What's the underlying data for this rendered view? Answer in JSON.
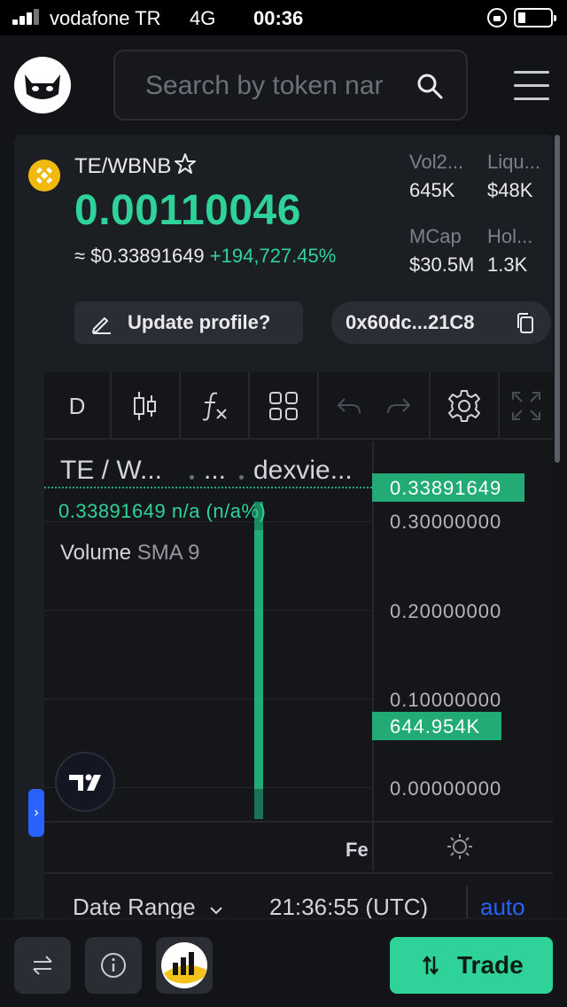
{
  "status_bar": {
    "carrier": "vodafone TR",
    "network": "4G",
    "time": "00:36"
  },
  "header": {
    "search_placeholder": "Search by token nar",
    "search_icon": "search-icon",
    "menu_icon": "hamburger-menu-icon",
    "logo_icon": "dextools-cat-logo"
  },
  "token": {
    "pair": "TE/WBNB",
    "chain_icon": "bnb-icon",
    "price": "0.00110046",
    "usd_approx": "≈",
    "usd_price": "$0.33891649",
    "change": "+194,727.45%",
    "stats": [
      {
        "label": "Vol2...",
        "value": "645K"
      },
      {
        "label": "Liqu...",
        "value": "$48K"
      },
      {
        "label": "MCap",
        "value": "$30.5M"
      },
      {
        "label": "Hol...",
        "value": "1.3K"
      }
    ],
    "update_profile_label": "Update profile?",
    "address_label": "0x60dc...21C8"
  },
  "chart": {
    "toolbar": {
      "interval": "D",
      "icons": [
        "candlestick-icon",
        "function-icon",
        "grid-layout-icon",
        "undo-icon",
        "redo-icon",
        "settings-icon",
        "fullscreen-icon"
      ]
    },
    "legend": {
      "title": "TE / W...",
      "dots": "...",
      "source": "dexvie...",
      "values": "0.33891649  n/a (n/a%)",
      "volume_label": "Volume",
      "volume_sma": "SMA 9"
    },
    "y_labels": [
      "0.30000000",
      "0.20000000",
      "0.10000000",
      "0.00000000"
    ],
    "price_tag": "0.33891649",
    "volume_tag": "644.954K",
    "x_label": "Fe",
    "date_range_label": "Date Range",
    "time_label": "21:36:55 (UTC)",
    "auto_label": "auto"
  },
  "chart_data": {
    "type": "bar",
    "title": "TE / W...",
    "categories": [
      "Fe"
    ],
    "series": [
      {
        "name": "Volume",
        "values": [
          644954
        ]
      }
    ],
    "ylim": [
      0,
      0.3
    ],
    "last_price": 0.33891649,
    "y_ticks": [
      0.0,
      0.1,
      0.2,
      0.3
    ],
    "grid": true
  },
  "bottom": {
    "swap_icon": "swap-arrows-icon",
    "info_icon": "info-icon",
    "chart_app_icon": "chart-app-icon",
    "trade_label": "Trade"
  },
  "colors": {
    "accent_green": "#2fd399",
    "chart_green": "#22ab74",
    "link_blue": "#2962ff",
    "background": "#121417"
  }
}
